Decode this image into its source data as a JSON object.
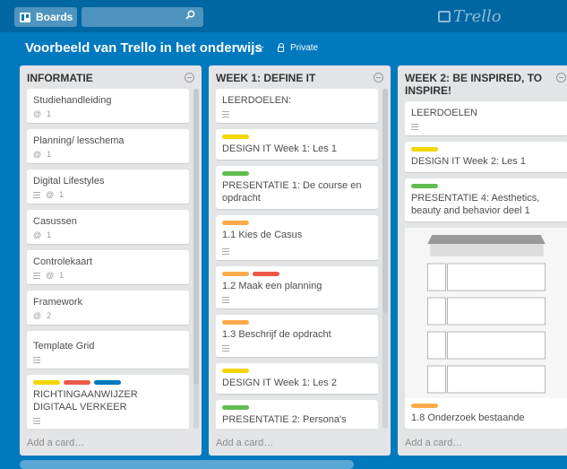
{
  "topbar": {
    "boards_label": "Boards",
    "logo_text": "Trello"
  },
  "board": {
    "title": "Voorbeeld van Trello in het onderwijs",
    "visibility": "Private"
  },
  "colors": {
    "yellow": "#f2d600",
    "red": "#eb5a46",
    "blue": "#0079bf",
    "green": "#61bd4f",
    "orange": "#ffab4a"
  },
  "lists": [
    {
      "title": "INFORMATIE",
      "add_card": "Add a card…",
      "cards": [
        {
          "title": "Studiehandleiding",
          "attachments": "1"
        },
        {
          "title": "Planning/ lesschema",
          "attachments": "1"
        },
        {
          "title": "Digital Lifestyles",
          "attachments": "1"
        },
        {
          "title": "Casussen",
          "attachments": "1"
        },
        {
          "title": "Controlekaart",
          "attachments": "1"
        },
        {
          "title": "Framework",
          "attachments": "2"
        },
        {
          "title": "Template Grid"
        },
        {
          "title": "RICHTINGAANWIJZER DIGITAAL VERKEER"
        }
      ]
    },
    {
      "title": "WEEK 1: DEFINE IT",
      "add_card": "Add a card…",
      "cards": [
        {
          "title": "LEERDOELEN:"
        },
        {
          "title": "DESIGN IT Week 1: Les 1"
        },
        {
          "title": "PRESENTATIE 1: De course en opdracht"
        },
        {
          "title": "1.1 Kies de Casus"
        },
        {
          "title": "1.2 Maak een planning"
        },
        {
          "title": "1.3 Beschrijf de opdracht"
        },
        {
          "title": "DESIGN IT Week 1: Les 2"
        },
        {
          "title": "PRESENTATIE 2: Persona's"
        }
      ]
    },
    {
      "title": "WEEK 2: BE INSPIRED, TO INSPIRE!",
      "add_card": "Add a card…",
      "cards": [
        {
          "title": "LEERDOELEN"
        },
        {
          "title": "DESIGN IT Week 2: Les 1"
        },
        {
          "title": "PRESENTATIE 4: Aesthetics, beauty and behavior deel 1"
        },
        {
          "title": "1.8 Onderzoek bestaande"
        }
      ]
    }
  ]
}
